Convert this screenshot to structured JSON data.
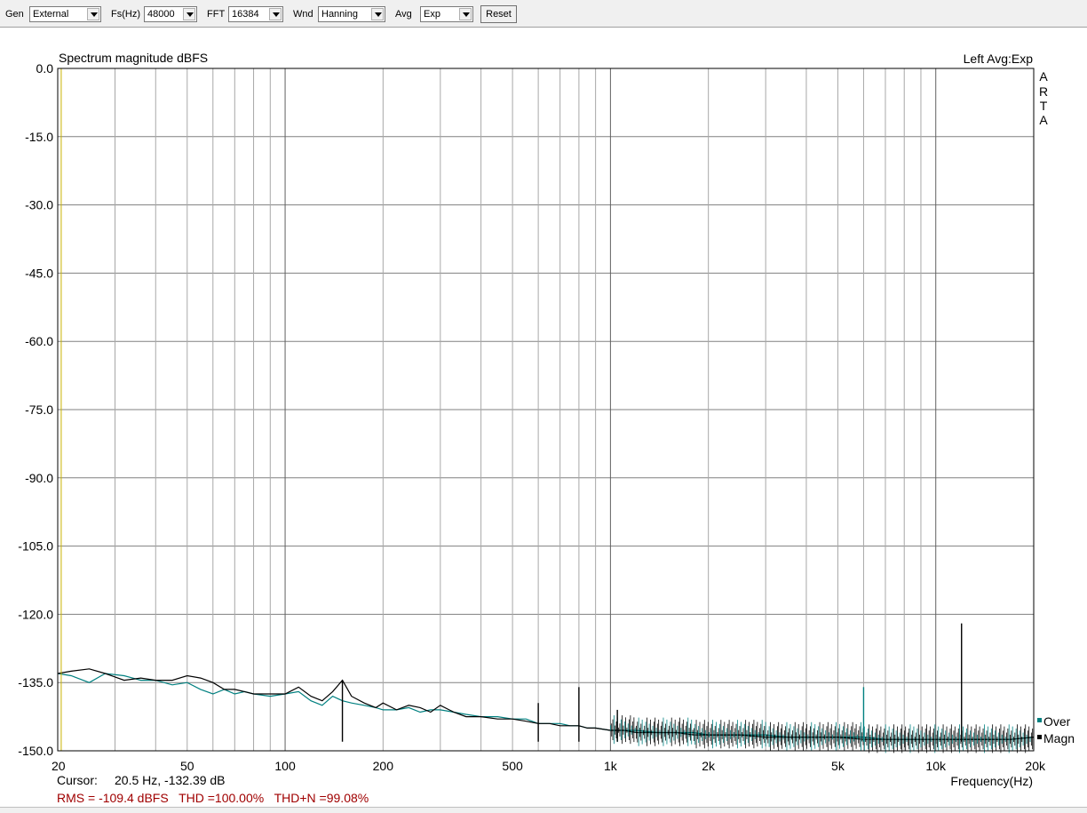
{
  "toolbar": {
    "gen": {
      "label": "Gen",
      "value": "External"
    },
    "fs": {
      "label": "Fs(Hz)",
      "value": "48000"
    },
    "fft": {
      "label": "FFT",
      "value": "16384"
    },
    "wnd": {
      "label": "Wnd",
      "value": "Hanning"
    },
    "avg": {
      "label": "Avg",
      "value": "Exp"
    },
    "reset_label": "Reset"
  },
  "plot": {
    "title": "Spectrum magnitude dBFS",
    "channel_info": "Left  Avg:Exp",
    "watermark": [
      "A",
      "R",
      "T",
      "A"
    ],
    "legend": [
      {
        "name": "Over",
        "color": "#008080"
      },
      {
        "name": "Magn",
        "color": "#000000"
      }
    ]
  },
  "status": {
    "cursor_label": "Cursor:",
    "cursor_value": "20.5 Hz, -132.39 dB",
    "measurements": "RMS = -109.4 dBFS   THD =100.00%   THD+N =99.08%"
  },
  "colors": {
    "grid": "#808080",
    "cursor": "#c8b400",
    "status_red": "#a00000",
    "over": "#008080",
    "magn": "#000000"
  },
  "chart_data": {
    "type": "line",
    "xlabel": "Frequency(Hz)",
    "x_scale": "log",
    "xlim": [
      20,
      20000
    ],
    "ylim": [
      -150,
      0
    ],
    "y_ticks": [
      0.0,
      -15.0,
      -30.0,
      -45.0,
      -60.0,
      -75.0,
      -90.0,
      -105.0,
      -120.0,
      -135.0,
      -150.0
    ],
    "y_tick_labels": [
      "0.0",
      "-15.0",
      "-30.0",
      "-45.0",
      "-60.0",
      "-75.0",
      "-90.0",
      "-105.0",
      "-120.0",
      "-135.0",
      "-150.0"
    ],
    "x_ticks": [
      20,
      50,
      100,
      200,
      500,
      1000,
      2000,
      5000,
      10000,
      20000
    ],
    "x_tick_labels": [
      "20",
      "50",
      "100",
      "200",
      "500",
      "1k",
      "2k",
      "5k",
      "10k",
      "20k"
    ],
    "grid": true,
    "cursor_x": 20.5,
    "series": [
      {
        "name": "Over",
        "color": "#008080",
        "x": [
          20,
          22,
          25,
          28,
          32,
          36,
          40,
          45,
          50,
          55,
          60,
          65,
          70,
          75,
          80,
          90,
          100,
          110,
          120,
          130,
          140,
          150,
          160,
          175,
          190,
          200,
          220,
          240,
          260,
          280,
          300,
          330,
          360,
          400,
          450,
          500,
          550,
          600,
          650,
          700,
          750,
          800,
          850,
          900,
          1000,
          1100,
          1200,
          1400,
          1600,
          1800,
          2000,
          2500,
          3000,
          3500,
          4000,
          5000,
          6000,
          7000,
          8000,
          9000,
          10000,
          12000,
          14000,
          17000,
          20000
        ],
        "y": [
          -133,
          -133.5,
          -135,
          -133,
          -133.5,
          -134.5,
          -134.5,
          -135.5,
          -135,
          -136.5,
          -137.5,
          -136.5,
          -137.5,
          -137,
          -137.5,
          -138,
          -137.5,
          -137,
          -139,
          -140,
          -138,
          -139,
          -139.5,
          -140,
          -140.5,
          -141,
          -141,
          -140.5,
          -141.5,
          -141,
          -141,
          -141.5,
          -142,
          -142.5,
          -142.5,
          -143,
          -143,
          -144,
          -144,
          -144,
          -144.5,
          -144.5,
          -145,
          -145,
          -145.5,
          -145.5,
          -145.5,
          -146,
          -146,
          -146,
          -146.5,
          -146.5,
          -146.5,
          -147,
          -147,
          -147,
          -147,
          -147.5,
          -147.5,
          -147.5,
          -147.5,
          -147.5,
          -147.5,
          -147.5,
          -147
        ]
      },
      {
        "name": "Magn",
        "color": "#000000",
        "x": [
          20,
          22,
          25,
          28,
          32,
          36,
          40,
          45,
          50,
          55,
          60,
          65,
          70,
          75,
          80,
          90,
          100,
          110,
          120,
          130,
          140,
          150,
          160,
          175,
          190,
          200,
          220,
          240,
          260,
          280,
          300,
          330,
          360,
          400,
          450,
          500,
          550,
          600,
          650,
          700,
          750,
          800,
          850,
          900,
          1000,
          1100,
          1200,
          1400,
          1600,
          1800,
          2000,
          2500,
          3000,
          3500,
          4000,
          5000,
          6000,
          7000,
          8000,
          9000,
          10000,
          12000,
          14000,
          17000,
          20000
        ],
        "y": [
          -133,
          -132.5,
          -132,
          -133,
          -134.5,
          -134,
          -134.5,
          -134.5,
          -133.5,
          -134,
          -135,
          -136.5,
          -136.5,
          -137,
          -137.5,
          -137.5,
          -137.5,
          -136,
          -138,
          -139,
          -137,
          -134.5,
          -138,
          -139.5,
          -140.5,
          -139.5,
          -141,
          -140,
          -140.5,
          -141.5,
          -140,
          -141.5,
          -142.5,
          -142.5,
          -143,
          -143,
          -143.5,
          -144,
          -144,
          -144.5,
          -144.5,
          -144.5,
          -145,
          -145,
          -145.5,
          -145.5,
          -146,
          -146,
          -146,
          -146.5,
          -146.5,
          -146.5,
          -147,
          -147,
          -147,
          -147,
          -147.5,
          -147.5,
          -147.5,
          -147.5,
          -147.5,
          -147.5,
          -147.5,
          -147.5,
          -147
        ]
      }
    ],
    "peaks": [
      {
        "series": "Magn",
        "x": 150,
        "y": -134.5
      },
      {
        "series": "Magn",
        "x": 600,
        "y": -139.5
      },
      {
        "series": "Magn",
        "x": 800,
        "y": -136
      },
      {
        "series": "Magn",
        "x": 1050,
        "y": -141
      },
      {
        "series": "Over",
        "x": 6000,
        "y": -136
      },
      {
        "series": "Magn",
        "x": 12000,
        "y": -122
      }
    ]
  }
}
